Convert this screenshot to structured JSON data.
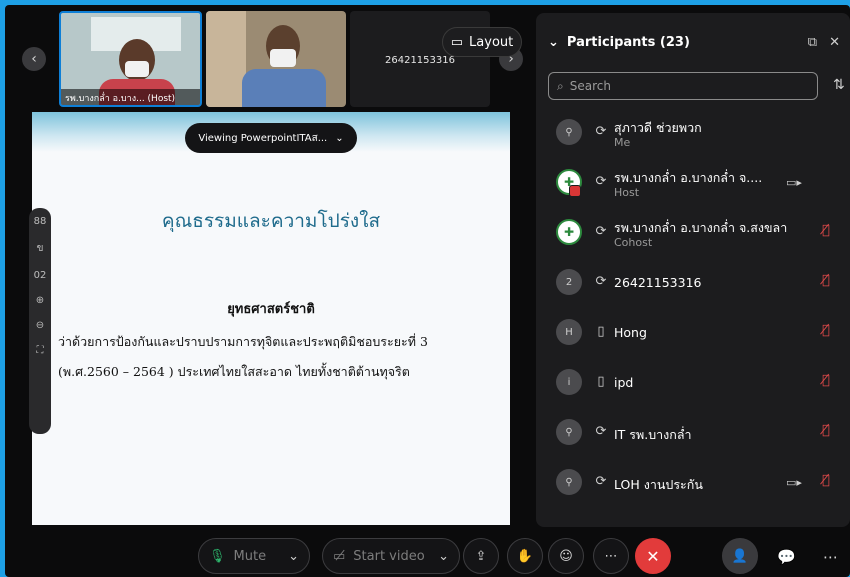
{
  "strip": {
    "tiles": [
      {
        "label": "รพ.บางกล่ำ อ.บาง... (Host)"
      },
      {
        "label": ""
      },
      {
        "label": "26421153316"
      }
    ],
    "layout_label": "Layout"
  },
  "share": {
    "viewing_label": "Viewing PowerpointITAส...",
    "slide": {
      "title": "คุณธรรมและความโปร่งใส",
      "subtitle": "ยุทธศาสตร์ชาติ",
      "line1": "ว่าด้วยการป้องกันและปราบปรามการทุจิตและประพฤติมิชอบระยะที่ 3",
      "line2": "(พ.ศ.2560 – 2564 ) ประเทศไทยใสสะอาด ไทยทั้งชาติต้านทุจริต"
    },
    "tools": [
      "88",
      "ข",
      "02"
    ]
  },
  "participants": {
    "title": "Participants (23)",
    "search_placeholder": "Search",
    "list": [
      {
        "initial": "",
        "name": "สุภาวดี ช่วยพวก",
        "role": "Me",
        "device": "⟳",
        "camera": false,
        "muted": false
      },
      {
        "initial": "✚",
        "name": "รพ.บางกล่ำ อ.บางกล่ำ จ....",
        "role": "Host",
        "device": "⟳",
        "camera": true,
        "muted": false
      },
      {
        "initial": "✚",
        "name": "รพ.บางกล่ำ อ.บางกล่ำ จ.สงขลา",
        "role": "Cohost",
        "device": "⟳",
        "camera": false,
        "muted": true
      },
      {
        "initial": "2",
        "name": "26421153316",
        "role": "",
        "device": "⟳",
        "camera": false,
        "muted": true
      },
      {
        "initial": "H",
        "name": "Hong",
        "role": "",
        "device": "▯",
        "camera": false,
        "muted": true
      },
      {
        "initial": "i",
        "name": "ipd",
        "role": "",
        "device": "▯",
        "camera": false,
        "muted": true
      },
      {
        "initial": "",
        "name": "IT รพ.บางกล่ำ",
        "role": "",
        "device": "⟳",
        "camera": false,
        "muted": true
      },
      {
        "initial": "",
        "name": "LOH งานประกัน",
        "role": "",
        "device": "⟳",
        "camera": true,
        "muted": true
      }
    ]
  },
  "controls": {
    "mute_label": "Mute",
    "video_label": "Start video"
  },
  "colors": {
    "accent": "#1ea0e6",
    "end": "#e23b3b"
  }
}
